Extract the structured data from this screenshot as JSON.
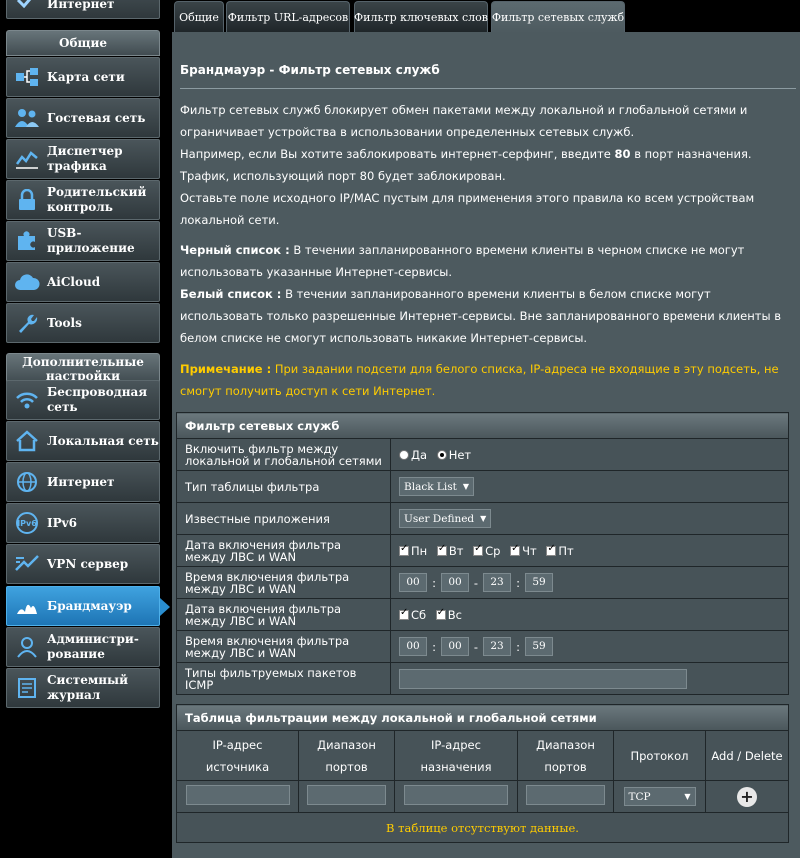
{
  "sidebar": {
    "top_item": "Интернет",
    "general_header": "Общие",
    "general_items": [
      {
        "label": "Карта сети",
        "icon": "network-map-icon"
      },
      {
        "label": "Гостевая сеть",
        "icon": "guest-network-icon"
      },
      {
        "label": "Диспетчер трафика",
        "icon": "traffic-manager-icon"
      },
      {
        "label": "Родительский контроль",
        "icon": "lock-icon"
      },
      {
        "label": "USB-приложение",
        "icon": "puzzle-icon"
      },
      {
        "label": "AiCloud",
        "icon": "cloud-icon"
      },
      {
        "label": "Tools",
        "icon": "wrench-icon"
      }
    ],
    "advanced_header": "Дополнительные настройки",
    "advanced_items": [
      {
        "label": "Беспроводная сеть",
        "icon": "wifi-icon"
      },
      {
        "label": "Локальная сеть",
        "icon": "home-icon"
      },
      {
        "label": "Интернет",
        "icon": "globe-icon"
      },
      {
        "label": "IPv6",
        "icon": "ipv6-icon"
      },
      {
        "label": "VPN сервер",
        "icon": "vpn-icon"
      },
      {
        "label": "Брандмауэр",
        "icon": "firewall-icon"
      },
      {
        "label": "Администри-рование",
        "icon": "admin-icon"
      },
      {
        "label": "Системный журнал",
        "icon": "log-icon"
      }
    ]
  },
  "tabs": [
    "Общие",
    "Фильтр URL-адресов",
    "Фильтр ключевых слов",
    "Фильтр сетевых служб"
  ],
  "page": {
    "title": "Брандмауэр - Фильтр сетевых служб",
    "p1": "Фильтр сетевых служб блокирует обмен пакетами между локальной и глобальной сетями и ограничивает устройства в использовании определенных сетевых служб.",
    "p2a": "Например, если Вы хотите заблокировать интернет-серфинг, введите",
    "p2b": "80",
    "p2c": "в порт назначения. Трафик, использующий порт 80 будет заблокирован.",
    "p3": "Оставьте поле исходного IP/MAC пустым для применения этого правила ко всем устройствам локальной сети.",
    "black_title": "Черный список :",
    "black_text": "В течении запланированного времени клиенты в черном списке не могут использовать указанные Интернет-сервисы.",
    "white_title": "Белый список :",
    "white_text": "В течении запланированного времени клиенты в белом списке могут использовать только разрешенные Интернет-сервисы. Вне запланированного времени клиенты в белом списке не смогут использовать никакие Интернет-сервисы.",
    "note_title": "Примечание :",
    "note_text": "При задании подсети для белого списка, IP-адреса не входящие в эту подсеть, не смогут получить доступ к сети Интернет."
  },
  "filter": {
    "header": "Фильтр сетевых служб",
    "enable_label": "Включить фильтр между локальной и глобальной сетями",
    "yes": "Да",
    "no": "Нет",
    "table_type_label": "Тип таблицы фильтра",
    "table_type_value": "Black List",
    "apps_label": "Известные приложения",
    "apps_value": "User Defined",
    "date1_label": "Дата включения фильтра между ЛВС и WAN",
    "days1": [
      "Пн",
      "Вт",
      "Ср",
      "Чт",
      "Пт"
    ],
    "time1_label": "Время включения фильтра между ЛВС и WAN",
    "time1": [
      "00",
      "00",
      "23",
      "59"
    ],
    "date2_label": "Дата включения фильтра между ЛВС и WAN",
    "days2": [
      "Сб",
      "Вс"
    ],
    "time2_label": "Время включения фильтра между ЛВС и WAN",
    "time2": [
      "00",
      "00",
      "23",
      "59"
    ],
    "icmp_label": "Типы фильтруемых пакетов ICMP",
    "icmp_value": ""
  },
  "rules": {
    "header": "Таблица фильтрации между локальной и глобальной сетями",
    "col_src": "IP-адрес источника",
    "col_src_ports": "Диапазон портов",
    "col_dst": "IP-адрес назначения",
    "col_dst_ports": "Диапазон портов",
    "col_proto": "Протокол",
    "col_action": "Add / Delete",
    "protocol_value": "TCP",
    "no_data": "В таблице отсутствуют данные."
  },
  "colors": {
    "accent": "#2a8ed0",
    "note": "#ffcc00",
    "panel": "#4d5a5f"
  }
}
